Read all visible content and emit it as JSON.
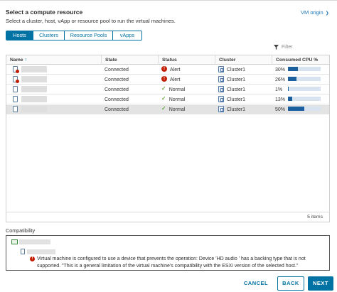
{
  "heading": "Select a compute resource",
  "subheading": "Select a cluster, host, vApp or resource pool to run the virtual machines.",
  "vm_origin_label": "VM origin",
  "tabs": [
    "Hosts",
    "Clusters",
    "Resource Pools",
    "vApps"
  ],
  "active_tab": "Hosts",
  "filter_placeholder": "Filter",
  "columns": {
    "name": "Name",
    "state": "State",
    "status": "Status",
    "cluster": "Cluster",
    "cpu": "Consumed CPU %"
  },
  "rows": [
    {
      "state": "Connected",
      "status": "Alert",
      "status_kind": "alert",
      "cluster": "Cluster1",
      "cpu": "30%",
      "cpu_fraction": 0.3,
      "host_alert": true
    },
    {
      "state": "Connected",
      "status": "Alert",
      "status_kind": "alert",
      "cluster": "Cluster1",
      "cpu": "26%",
      "cpu_fraction": 0.26,
      "host_alert": true
    },
    {
      "state": "Connected",
      "status": "Normal",
      "status_kind": "normal",
      "cluster": "Cluster1",
      "cpu": "1%",
      "cpu_fraction": 0.01,
      "host_alert": false
    },
    {
      "state": "Connected",
      "status": "Normal",
      "status_kind": "normal",
      "cluster": "Cluster1",
      "cpu": "13%",
      "cpu_fraction": 0.13,
      "host_alert": false
    },
    {
      "state": "Connected",
      "status": "Normal",
      "status_kind": "normal",
      "cluster": "Cluster1",
      "cpu": "50%",
      "cpu_fraction": 0.5,
      "host_alert": false,
      "selected": true
    }
  ],
  "item_count": "5 items",
  "compatibility": {
    "label": "Compatibility",
    "message": "Virtual machine is configured to use a device that prevents the operation: Device 'HD audio ' has a backing type that is not supported. \"This is a general limitation of the virtual machine's compatibility with the ESXi version of the selected host.\""
  },
  "buttons": {
    "cancel": "CANCEL",
    "back": "BACK",
    "next": "NEXT"
  },
  "colors": {
    "accent": "#0072a3",
    "alert": "#c21d00",
    "normal": "#2f8400",
    "cpu_bar": "#1b5f9e"
  }
}
